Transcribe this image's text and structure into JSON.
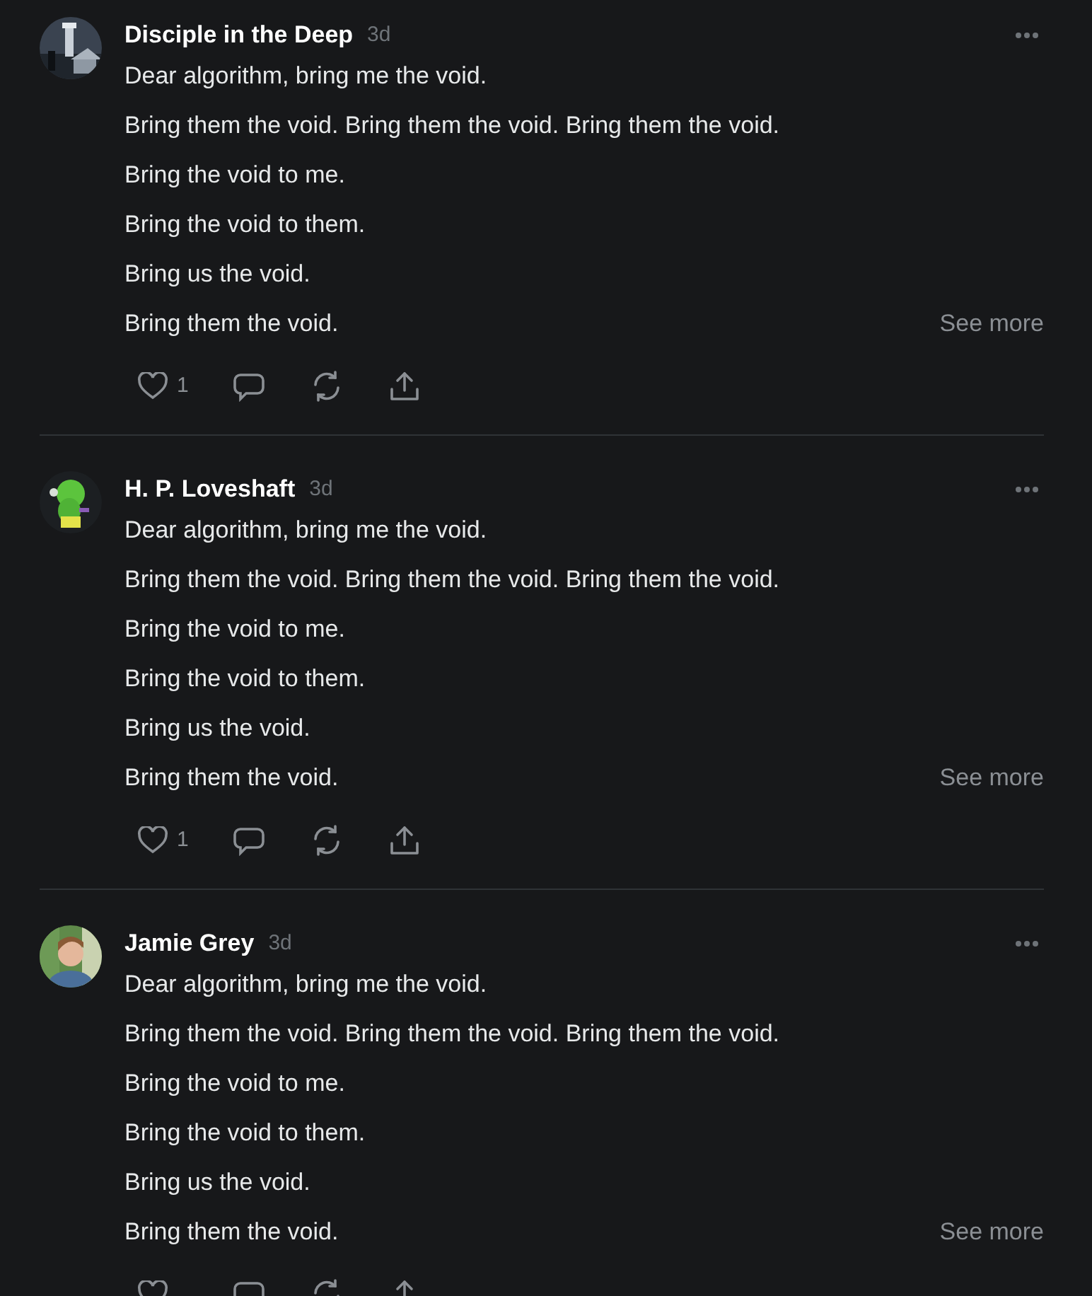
{
  "posts": [
    {
      "author": "Disciple in the Deep",
      "time": "3d",
      "lines": [
        "Dear algorithm, bring me the void.",
        "Bring them the void. Bring them the void. Bring them the void.",
        "Bring the void to me.",
        "Bring the void to them.",
        "Bring us the void.",
        "Bring them the void."
      ],
      "see_more": "See more",
      "likes": "1"
    },
    {
      "author": "H. P. Loveshaft",
      "time": "3d",
      "lines": [
        "Dear algorithm, bring me the void.",
        "Bring them the void. Bring them the void. Bring them the void.",
        "Bring the void to me.",
        "Bring the void to them.",
        "Bring us the void.",
        "Bring them the void."
      ],
      "see_more": "See more",
      "likes": "1"
    },
    {
      "author": "Jamie Grey",
      "time": "3d",
      "lines": [
        "Dear algorithm, bring me the void.",
        "Bring them the void. Bring them the void. Bring them the void.",
        "Bring the void to me.",
        "Bring the void to them.",
        "Bring us the void.",
        "Bring them the void."
      ],
      "see_more": "See more"
    }
  ]
}
